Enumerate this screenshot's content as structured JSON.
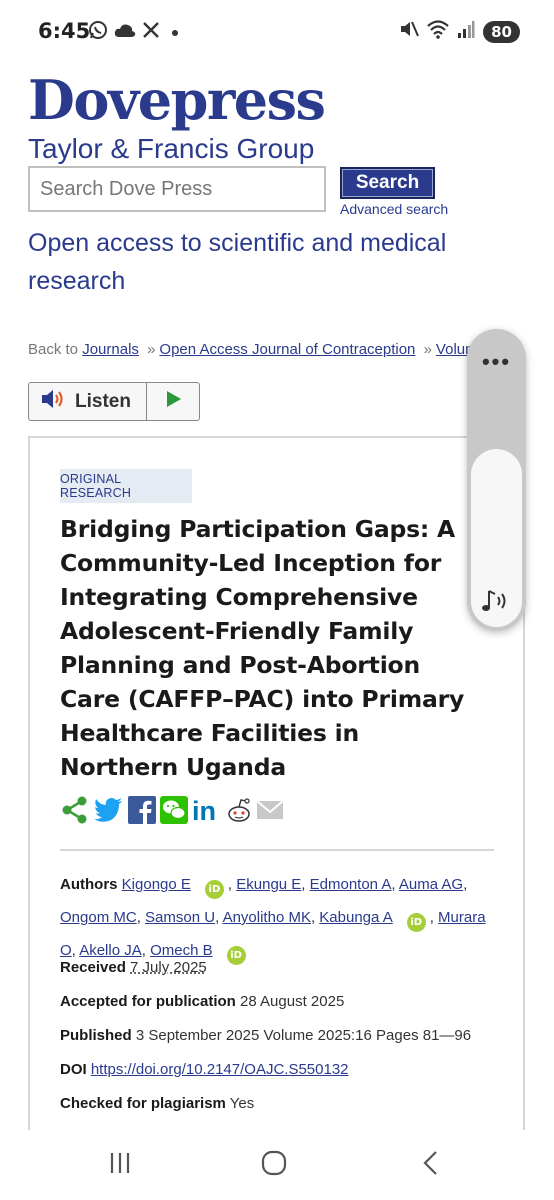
{
  "status_bar": {
    "time": "6:45",
    "battery": "80",
    "icons": [
      "whatsapp-icon",
      "cloud-icon",
      "x-icon",
      "dot-icon",
      "mute-icon",
      "wifi-icon",
      "signal-icon"
    ]
  },
  "header": {
    "logo": "Dovepress",
    "group": "Taylor & Francis Group",
    "search_placeholder": "Search Dove Press",
    "search_button": "Search",
    "advanced_search": "Advanced search",
    "intro_line1": "Open access to scientific and medical",
    "intro_line2": "research"
  },
  "breadcrumb": {
    "prefix": "Back to",
    "items": [
      "Journals",
      "Open Access Journal of Contraception",
      "Volume"
    ],
    "separator": "»"
  },
  "listen": {
    "label": "Listen"
  },
  "article": {
    "badge": "ORIGINAL RESEARCH",
    "title": "Bridging Participation Gaps: A Community-Led Inception for Integrating Comprehensive Adolescent-Friendly Family Planning and Post-Abortion Care (CAFFP–PAC) into Primary Healthcare Facilities in Northern Uganda",
    "share_icons": [
      "share-icon",
      "twitter-icon",
      "facebook-icon",
      "wechat-icon",
      "linkedin-icon",
      "reddit-icon",
      "email-icon"
    ],
    "authors_label": "Authors",
    "authors": [
      "Kigongo E",
      "Ekungu E",
      "Edmonton A",
      "Auma AG",
      "Ongom MC",
      "Samson U",
      "Anyolitho MK",
      "Kabunga A",
      "Murara O",
      "Akello JA",
      "Omech B"
    ],
    "received_label": "Received",
    "received": "7 July 2025",
    "accepted_label": "Accepted for publication",
    "accepted": "28 August 2025",
    "published_label": "Published",
    "published": "3 September 2025 Volume 2025:16 Pages 81—96",
    "doi_label": "DOI",
    "doi": "https://doi.org/10.2147/OAJC.S550132",
    "plagiarism_label": "Checked for plagiarism",
    "plagiarism": "Yes"
  },
  "side_panel": {
    "more": "•••"
  },
  "nav": [
    "recents-icon",
    "home-icon",
    "back-icon"
  ],
  "colors": {
    "brand": "#2a3a8c",
    "orcid": "#a6ce39",
    "share_green": "#3a9d3a"
  }
}
